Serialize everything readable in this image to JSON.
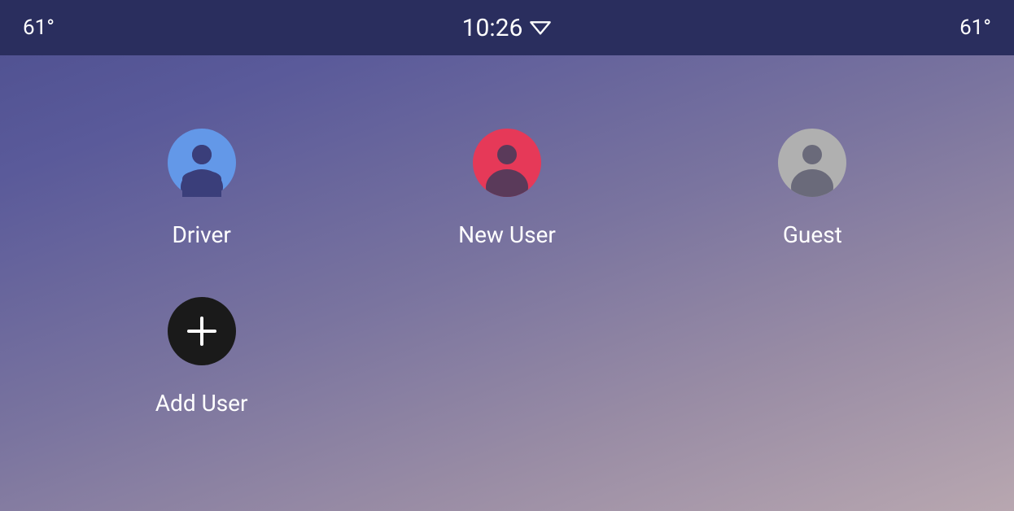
{
  "status_bar": {
    "left_temp": "61°",
    "time": "10:26",
    "right_temp": "61°"
  },
  "users": [
    {
      "label": "Driver",
      "color": "#6398e8"
    },
    {
      "label": "New User",
      "color": "#e63958"
    },
    {
      "label": "Guest",
      "color": "#b0b0b0"
    }
  ],
  "add_user_label": "Add User"
}
